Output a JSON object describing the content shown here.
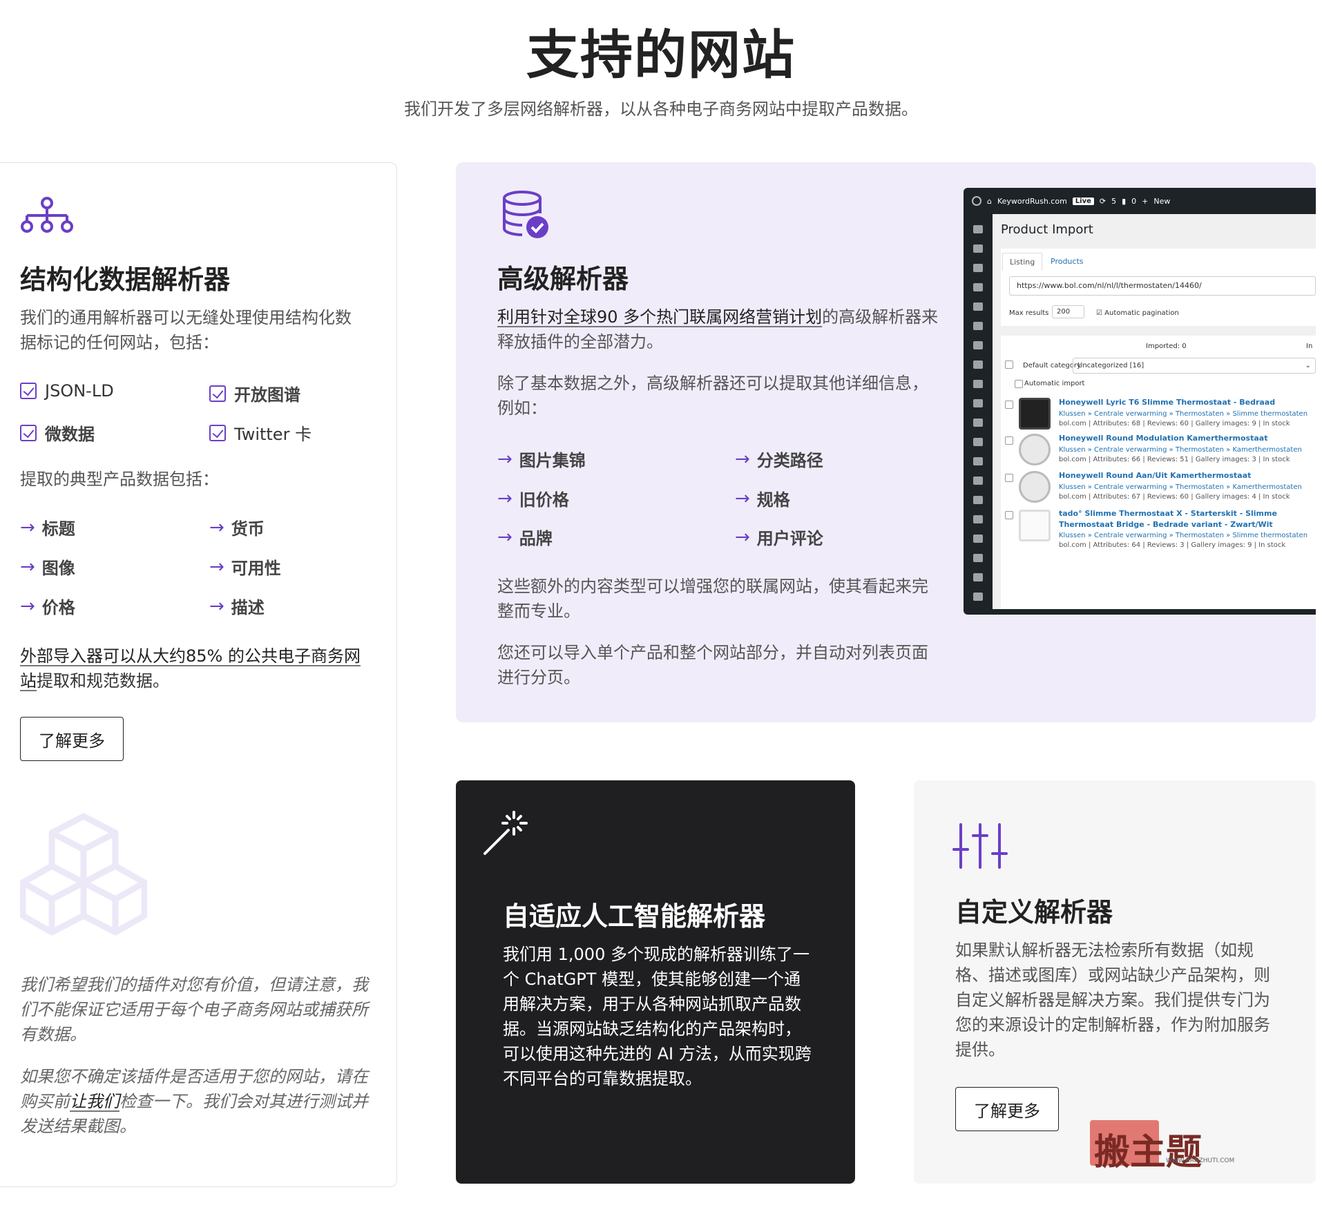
{
  "header": {
    "title": "支持的网站",
    "subtitle": "我们开发了多层网络解析器，以从各种电子商务网站中提取产品数据。"
  },
  "structured": {
    "icon": "sitemap-icon",
    "title": "结构化数据解析器",
    "desc": "我们的通用解析器可以无缝处理使用结构化数据标记的任何网站，包括：",
    "formats": [
      "JSON-LD",
      "开放图谱",
      "微数据",
      "Twitter 卡"
    ],
    "extract_label": "提取的典型产品数据包括：",
    "fields": [
      "标题",
      "货币",
      "图像",
      "可用性",
      "价格",
      "描述"
    ],
    "coverage_link": "外部导入器可以从大约85% 的公共电子商务网站",
    "coverage_rest": "提取和规范数据。",
    "button": "了解更多",
    "cube_icon": "cubes-icon",
    "disclaimer1": "我们希望我们的插件对您有价值，但请注意，我们不能保证它适用于每个电子商务网站或捕获所有数据。",
    "disclaimer2_pre": "如果您不确定该插件是否适用于您的网站，请在购买前",
    "disclaimer2_link": "让我们",
    "disclaimer2_post": "检查一下。我们会对其进行测试并发送结果截图。"
  },
  "advanced": {
    "icon": "database-check-icon",
    "title": "高级解析器",
    "p1_link": "利用针对全球90 多个热门联属网络营销计划",
    "p1_rest": "的高级解析器来释放插件的全部潜力。",
    "p2": "除了基本数据之外，高级解析器还可以提取其他详细信息，例如：",
    "fields": [
      "图片集锦",
      "分类路径",
      "旧价格",
      "规格",
      "品牌",
      "用户评论"
    ],
    "p3": "这些额外的内容类型可以增强您的联属网站，使其看起来完整而专业。",
    "p4": "您还可以导入单个产品和整个网站部分，并自动对列表页面进行分页。"
  },
  "screenshot": {
    "site": "KeywordRush.com",
    "live": "Live",
    "updates": "5",
    "comments": "0",
    "new": "New",
    "title": "Product Import",
    "tab1": "Listing",
    "tab2": "Products",
    "url": "https://www.bol.com/nl/nl/l/thermostaten/14460/",
    "max_label": "Max results",
    "max_value": "200",
    "pagination": "Automatic pagination",
    "imported": "Imported: 0",
    "in_label": "In",
    "default_cat": "Default category",
    "cat_value": "Uncategorized [16]",
    "auto_import": "Automatic import",
    "products": [
      {
        "title": "Honeywell Lyric T6 Slimme Thermostaat - Bedraad",
        "path": "Klussen » Centrale verwarming » Thermostaten » Slimme thermostaten",
        "meta": "bol.com | Attributes: 68 | Reviews: 60 | Gallery images: 9 | In stock"
      },
      {
        "title": "Honeywell Round Modulation Kamerthermostaat",
        "path": "Klussen » Centrale verwarming » Thermostaten » Kamerthermostaten",
        "meta": "bol.com | Attributes: 66 | Reviews: 51 | Gallery images: 3 | In stock"
      },
      {
        "title": "Honeywell Round Aan/Uit Kamerthermostaat",
        "path": "Klussen » Centrale verwarming » Thermostaten » Kamerthermostaten",
        "meta": "bol.com | Attributes: 67 | Reviews: 60 | Gallery images: 4 | In stock"
      },
      {
        "title": "tado° Slimme Thermostaat X - Starterskit - Slimme Thermostaat Bridge - Bedrade variant - Zwart/Wit",
        "path": "Klussen » Centrale verwarming » Thermostaten » Slimme thermostaten",
        "meta": "bol.com | Attributes: 64 | Reviews: 3 | Gallery images: 9 | In stock"
      }
    ]
  },
  "ai": {
    "icon": "magic-wand-icon",
    "title": "自适应人工智能解析器",
    "desc": "我们用 1,000 多个现成的解析器训练了一个 ChatGPT 模型，使其能够创建一个通用解决方案，用于从各种网站抓取产品数据。当源网站缺乏结构化的产品架构时，可以使用这种先进的 AI 方法，从而实现跨不同平台的可靠数据提取。"
  },
  "custom": {
    "icon": "sliders-icon",
    "title": "自定义解析器",
    "desc": "如果默认解析器无法检索所有数据（如规格、描述或图库）或网站缺少产品架构，则自定义解析器是解决方案。我们提供专门为您的来源设计的定制解析器，作为附加服务提供。",
    "button": "了解更多"
  },
  "watermark": {
    "text": "搬主题",
    "url": "WWW.BANZHUTI.COM"
  },
  "colors": {
    "accent": "#6a3fc6",
    "adv_bg": "#f0ecfa",
    "dark_card": "#1f1f22"
  }
}
